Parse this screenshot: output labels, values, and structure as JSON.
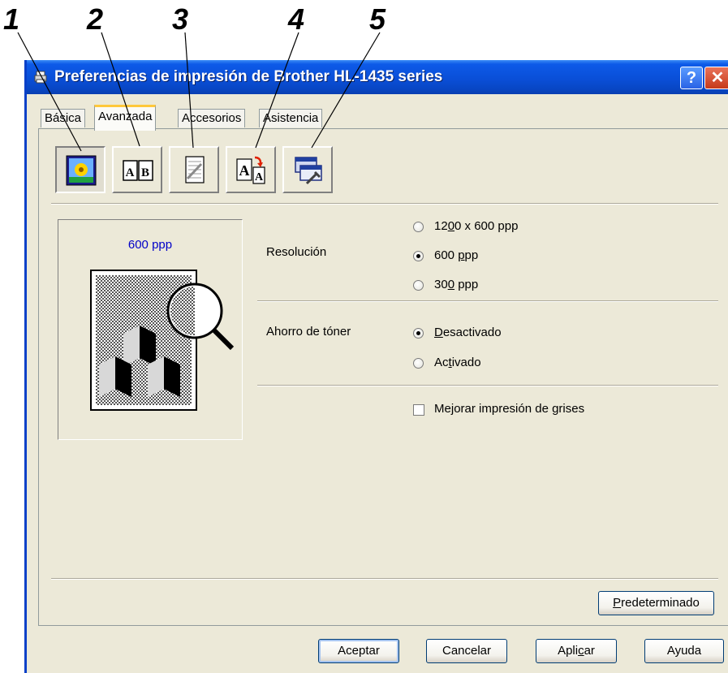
{
  "callouts": [
    "1",
    "2",
    "3",
    "4",
    "5"
  ],
  "window": {
    "title": "Preferencias de impresión de Brother HL-1435 series",
    "help_label": "?",
    "close_label": "✕"
  },
  "tabs": [
    {
      "label": "Básica",
      "active": false
    },
    {
      "label": "Avanzada",
      "active": true
    },
    {
      "label": "Accesorios",
      "active": false
    },
    {
      "label": "Asistencia",
      "active": false
    }
  ],
  "toolbar": [
    {
      "icon": "print-quality-icon",
      "pressed": true
    },
    {
      "icon": "duplex-print-icon",
      "pressed": false
    },
    {
      "icon": "watermark-icon",
      "pressed": false
    },
    {
      "icon": "page-setting-icon",
      "pressed": false
    },
    {
      "icon": "device-options-icon",
      "pressed": false
    }
  ],
  "preview": {
    "caption": "600 ppp",
    "image": "resolution-preview-icon"
  },
  "resolution": {
    "label": "Resolución",
    "options": [
      {
        "pre": "12",
        "key": "0",
        "post": "0 x 600 ppp",
        "checked": false
      },
      {
        "pre": "600 ",
        "key": "p",
        "post": "pp",
        "checked": true
      },
      {
        "pre": "30",
        "key": "0",
        "post": " ppp",
        "checked": false
      }
    ]
  },
  "toner_save": {
    "label": "Ahorro de tóner",
    "options": [
      {
        "pre": "",
        "key": "D",
        "post": "esactivado",
        "checked": true
      },
      {
        "pre": "Ac",
        "key": "t",
        "post": "ivado",
        "checked": false
      }
    ]
  },
  "gray": {
    "pre": "Me",
    "key": "j",
    "post": "orar impresión de grises",
    "checked": false
  },
  "default_button": {
    "pre": "",
    "key": "P",
    "post": "redeterminado"
  },
  "footer": {
    "ok": "Aceptar",
    "cancel": "Cancelar",
    "apply_pre": "Apli",
    "apply_key": "c",
    "apply_post": "ar",
    "help": "Ayuda"
  },
  "colors": {
    "titlebar": "#0a4fd8",
    "face": "#ece9d8",
    "tab_highlight": "#ffc83c",
    "caption": "#0000c8"
  }
}
